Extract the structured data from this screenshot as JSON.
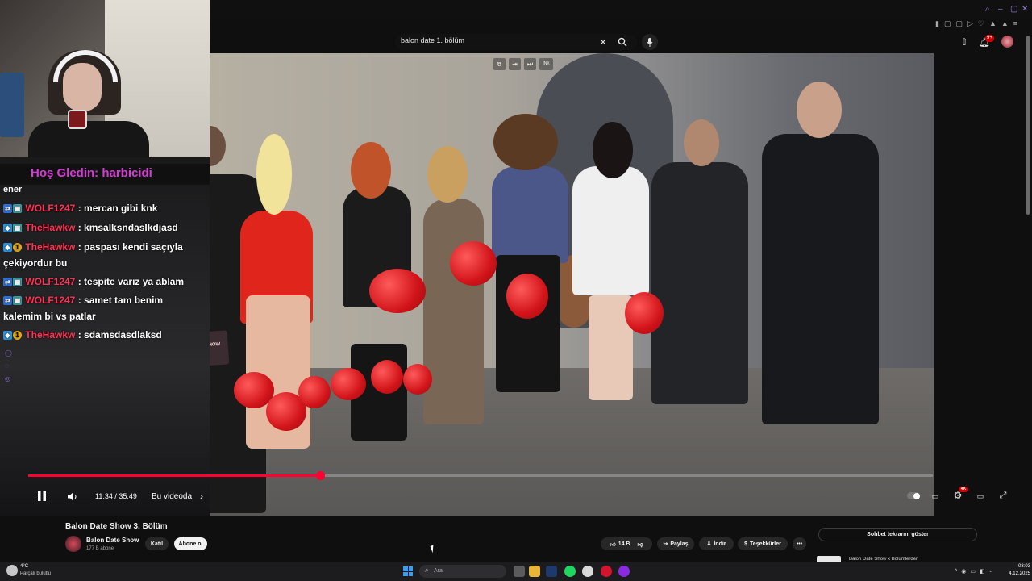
{
  "search": {
    "query": "balon date 1. bölüm"
  },
  "header": {
    "notif_count": "9+"
  },
  "overlay": {
    "welcome": "Hoş Gledin: harbicidi",
    "chat_fragment": "ener"
  },
  "chat": [
    {
      "name": "WOLF1247",
      "msg": ": mercan gibi knk",
      "cont": ""
    },
    {
      "name": "TheHawkw",
      "msg": ": kmsalksndaslkdjasd",
      "cont": ""
    },
    {
      "name": "TheHawkw",
      "msg": ": paspası kendi saçıyla",
      "cont": "çekiyordur bu"
    },
    {
      "name": "WOLF1247",
      "msg": ": tespite varız ya ablam",
      "cont": ""
    },
    {
      "name": "WOLF1247",
      "msg": ": samet tam benim",
      "cont": "kalemim bi vs patlar"
    },
    {
      "name": "TheHawkw",
      "msg": ": sdamsdasdlaksd",
      "cont": ""
    }
  ],
  "player": {
    "time": "11:34 / 35:49",
    "progress": 0.323,
    "chapter": "Bu videoda",
    "quality_badge": "4K",
    "sign_text": "BALON DATE SHOW",
    "mini_label": "INX"
  },
  "video": {
    "title": "Balon Date Show 3. Bölüm",
    "channel": "Balon Date Show",
    "subs": "177 B abone",
    "join": "Katıl",
    "subscribe": "Abone ol",
    "likes": "14 B",
    "share": "Paylaş",
    "download": "İndir",
    "thanks": "Teşekkürler"
  },
  "sidebar": {
    "chat_replay": "Sohbet tekrarını göster",
    "next_item": "Balon Date Show x Bölümlerden"
  },
  "taskbar": {
    "weather_temp": "4°C",
    "weather_desc": "Parçalı bulutlu",
    "search_placeholder": "Ara",
    "time": "03:03",
    "date": "4.12.2025"
  },
  "colors": {
    "accent": "#ff0033",
    "chat_name": "#ff3355",
    "welcome": "#d63bd6"
  }
}
